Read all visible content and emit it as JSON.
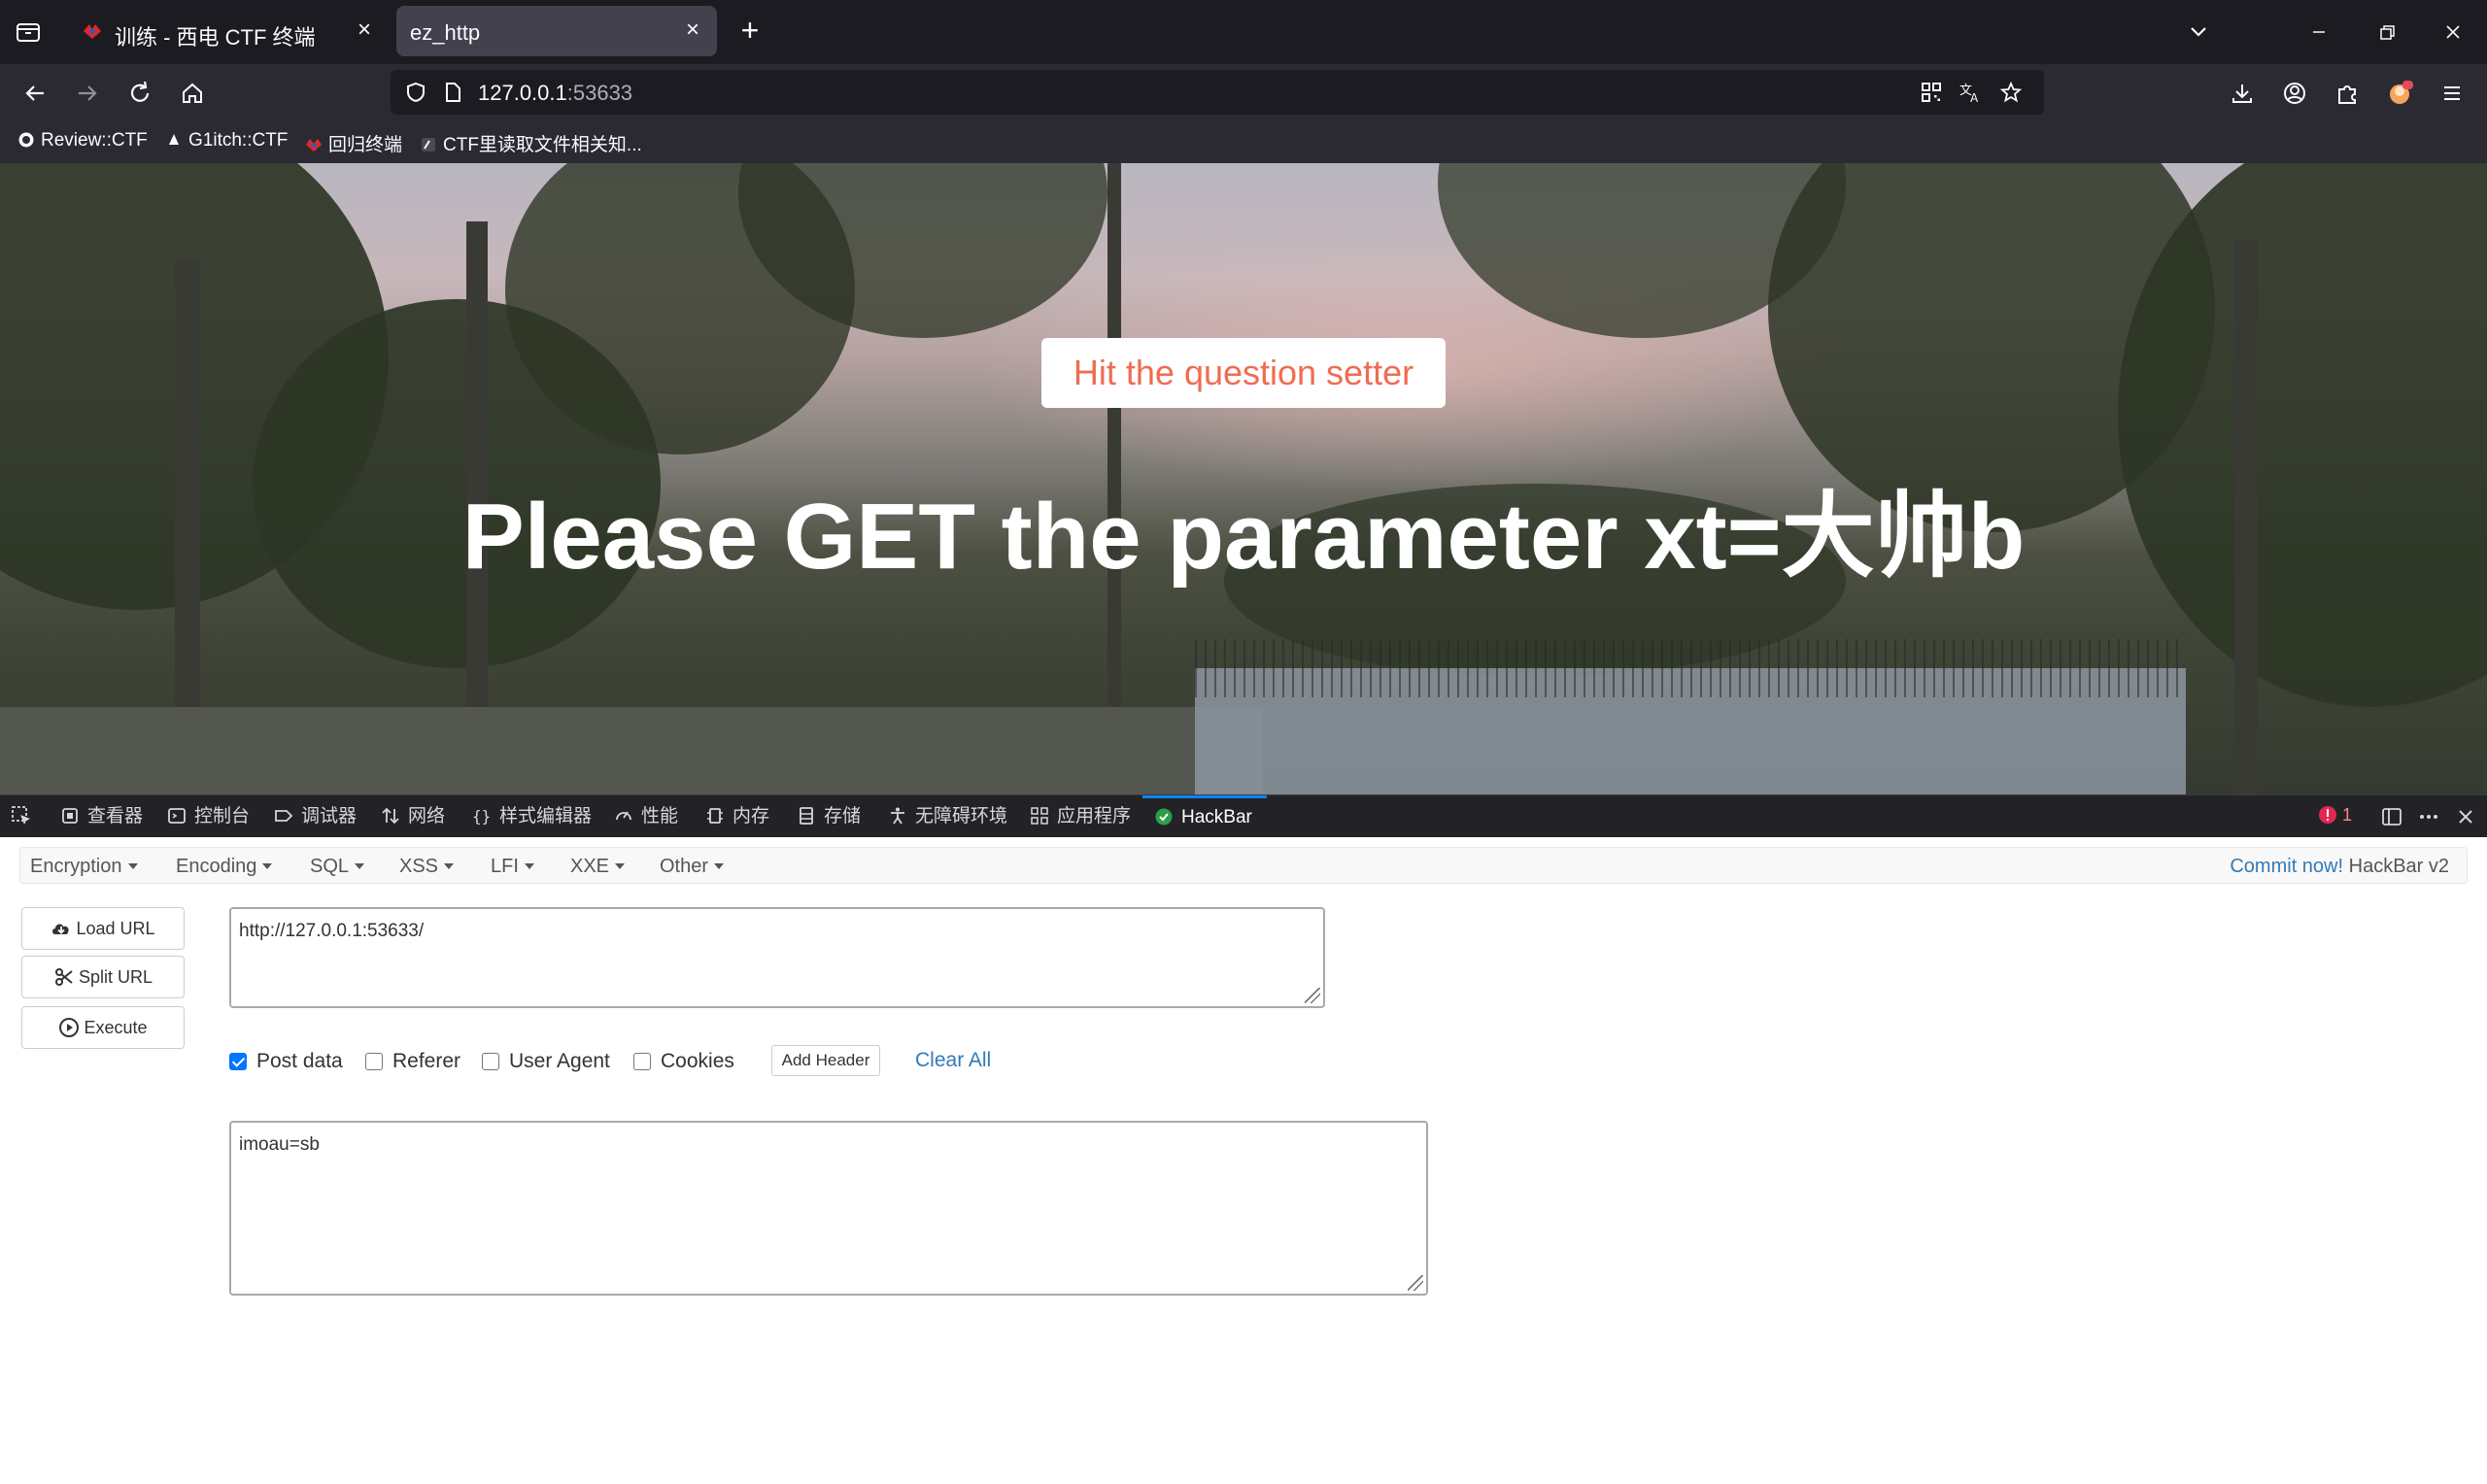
{
  "browser": {
    "tabs": [
      {
        "title": "训练 - 西电 CTF 终端",
        "active": false
      },
      {
        "title": "ez_http",
        "active": true
      }
    ],
    "new_tab_symbol": "+",
    "close_symbol": "×",
    "url": {
      "host": "127.0.0.1",
      "port": ":53633"
    },
    "bookmarks": [
      {
        "label": "Review::CTF",
        "icon": "globe-icon"
      },
      {
        "label": "G1itch::CTF",
        "icon": "glitch-icon"
      },
      {
        "label": "回归终端",
        "icon": "terminal-icon"
      },
      {
        "label": "CTF里读取文件相关知...",
        "icon": "doc-icon"
      }
    ]
  },
  "page": {
    "hit_button": "Hit the question setter",
    "headline": "Please GET the parameter xt=大帅b"
  },
  "devtools": {
    "tabs": [
      {
        "label": "查看器",
        "icon": "inspector-icon"
      },
      {
        "label": "控制台",
        "icon": "console-icon"
      },
      {
        "label": "调试器",
        "icon": "debugger-icon"
      },
      {
        "label": "网络",
        "icon": "network-icon"
      },
      {
        "label": "样式编辑器",
        "icon": "style-editor-icon"
      },
      {
        "label": "性能",
        "icon": "performance-icon"
      },
      {
        "label": "内存",
        "icon": "memory-icon"
      },
      {
        "label": "存储",
        "icon": "storage-icon"
      },
      {
        "label": "无障碍环境",
        "icon": "accessibility-icon"
      },
      {
        "label": "应用程序",
        "icon": "application-icon"
      },
      {
        "label": "HackBar",
        "icon": "hackbar-icon"
      }
    ],
    "error_count": "1"
  },
  "hackbar": {
    "menu": [
      "Encryption",
      "Encoding",
      "SQL",
      "XSS",
      "LFI",
      "XXE",
      "Other"
    ],
    "commit_link": "Commit now!",
    "version": "HackBar v2",
    "buttons": {
      "load_url": "Load URL",
      "split_url": "Split URL",
      "execute": "Execute"
    },
    "url_value": "http://127.0.0.1:53633/",
    "options": [
      {
        "label": "Post data",
        "checked": true
      },
      {
        "label": "Referer",
        "checked": false
      },
      {
        "label": "User Agent",
        "checked": false
      },
      {
        "label": "Cookies",
        "checked": false
      }
    ],
    "add_header": "Add Header",
    "clear_all": "Clear All",
    "post_body": "imoau=sb"
  },
  "colors": {
    "accent_blue": "#0a84ff",
    "link_blue": "#337ab7",
    "hit_button_text": "#ef6c50"
  }
}
